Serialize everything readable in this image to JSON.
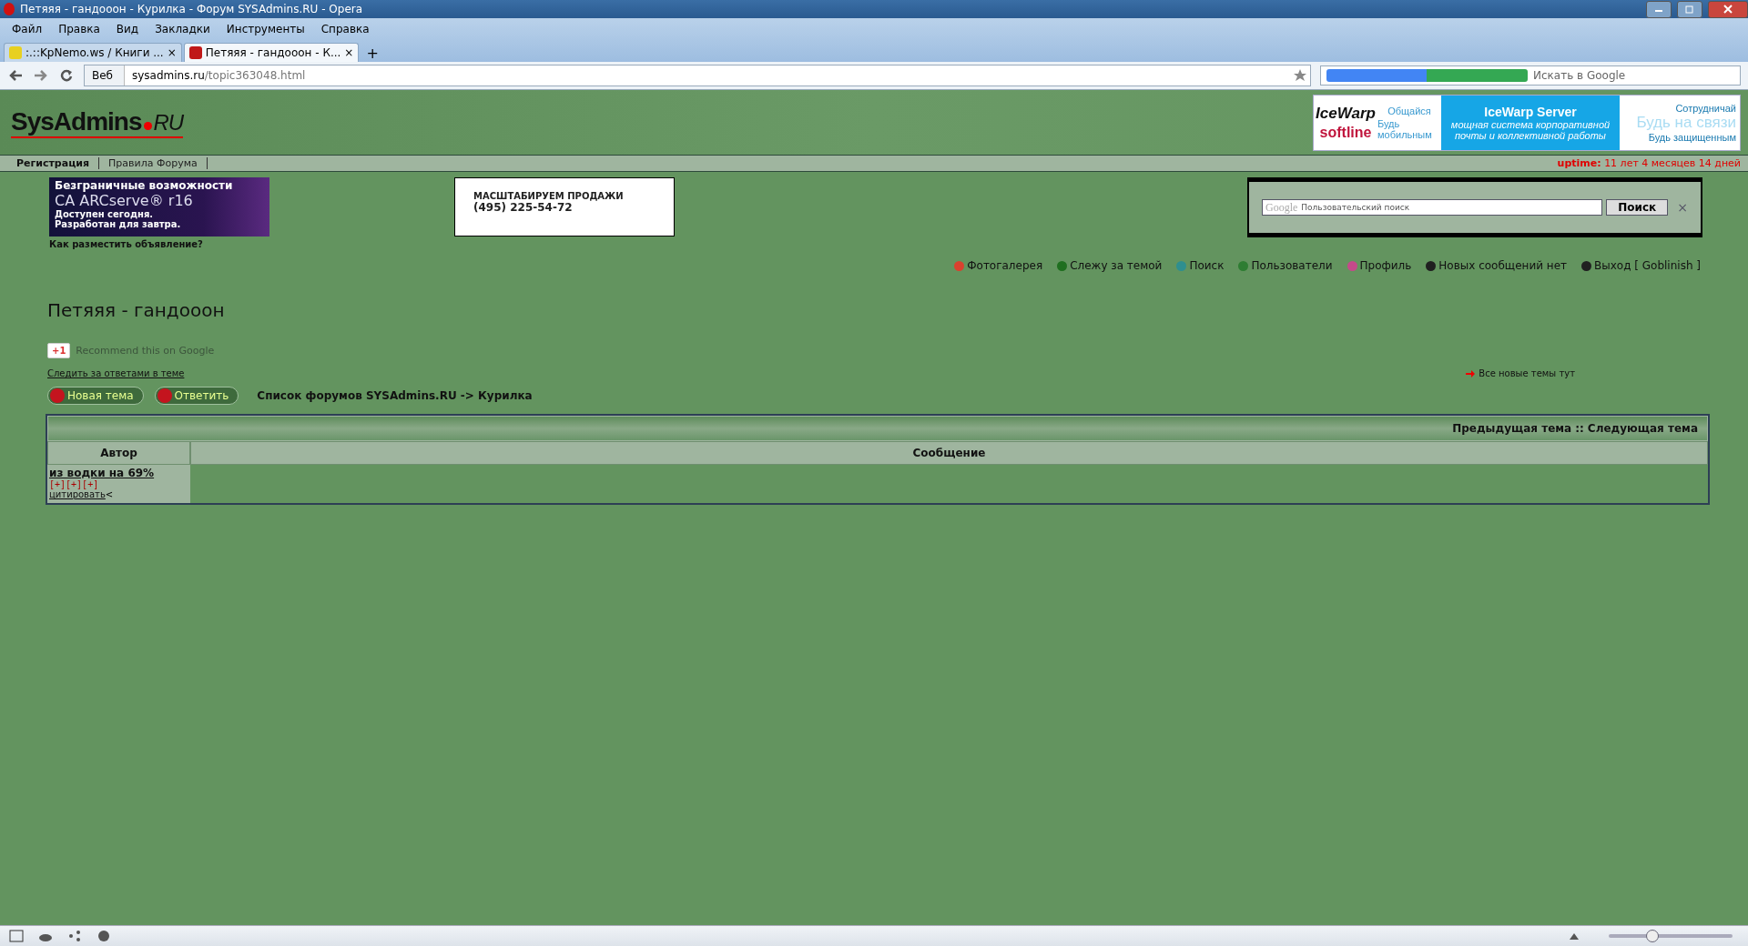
{
  "window": {
    "title": "Петяяя - гандооон - Курилка - Форум SYSAdmins.RU - Opera"
  },
  "menu": [
    "Файл",
    "Правка",
    "Вид",
    "Закладки",
    "Инструменты",
    "Справка"
  ],
  "tabs": [
    {
      "label": ":.::KpNemo.ws / Книги ...",
      "close": "×",
      "selected": false
    },
    {
      "label": "Петяяя - гандооон - К...",
      "close": "×",
      "selected": true
    }
  ],
  "new_tab": "+",
  "address_bar": {
    "mode": "Веб",
    "domain": "sysadmins.ru",
    "path": "/topic363048.html"
  },
  "search_bar": {
    "placeholder": "Искать в Google"
  },
  "site_header": {
    "logo": "SysAdmins",
    "logo_suffix": "RU",
    "banner": {
      "brand": "IceWarp",
      "partner": "softline",
      "left": [
        "Общайся",
        "Будь мобильным"
      ],
      "title": "IceWarp Server",
      "text": "мощная система корпоративной почты и коллективной работы",
      "right": [
        "Сотрудничай",
        "Будь на связи",
        "Будь защищенным"
      ]
    }
  },
  "nav_links": [
    {
      "label": "Регистрация",
      "selected": true
    },
    {
      "label": "Правила Форума",
      "selected": false
    }
  ],
  "uptime": {
    "label": "uptime:",
    "value": "11 лет 4 месяцев 14 дней"
  },
  "ads": [
    {
      "kind": "dark",
      "lines": [
        "Безграничные возможности",
        "CA ARCserve® r16",
        "Доступен сегодня.",
        "Разработан для завтра."
      ]
    },
    {
      "kind": "light",
      "lines": [
        "МАСШТАБИРУЕМ ПРОДАЖИ",
        "(495) 225-54-72"
      ]
    }
  ],
  "ad_link": "Как разместить объявление?",
  "custom_search": {
    "brand": "Google",
    "placeholder": "Пользовательский поиск",
    "button": "Поиск",
    "close": "×"
  },
  "user_links": [
    {
      "label": "Фотогалерея",
      "color": "#d9412e"
    },
    {
      "label": "Слежу за темой",
      "color": "#1f6f1f"
    },
    {
      "label": "Поиск",
      "color": "#2f8f8f"
    },
    {
      "label": "Пользователи",
      "color": "#2e7d32"
    },
    {
      "label": "Профиль",
      "color": "#c44a8a"
    },
    {
      "label": "Новых сообщений нет",
      "color": "#202020"
    },
    {
      "label": "Выход [ Goblinish ]",
      "color": "#202020"
    }
  ],
  "topic": {
    "title": "Петяяя - гандооон",
    "plus_one": "+1",
    "recommend": "Recommend this on Google",
    "watch_link": "Следить за ответами в теме",
    "new_topics_link": "Все новые темы тут",
    "buttons": [
      "Новая тема",
      "Ответить"
    ],
    "breadcrumb": "Список форумов SYSAdmins.RU -> Курилка"
  },
  "table": {
    "prev": "Предыдущая тема",
    "separator": "::",
    "next": "Следующая тема",
    "columns": [
      "Автор",
      "Сообщение"
    ],
    "rows": [
      {
        "author": "из водки на 69%",
        "marks": "[+][+][+]",
        "quote": "цитировать",
        "after": "<"
      }
    ]
  },
  "status_bar": {
    "zoom": {
      "level": 0.32
    }
  }
}
